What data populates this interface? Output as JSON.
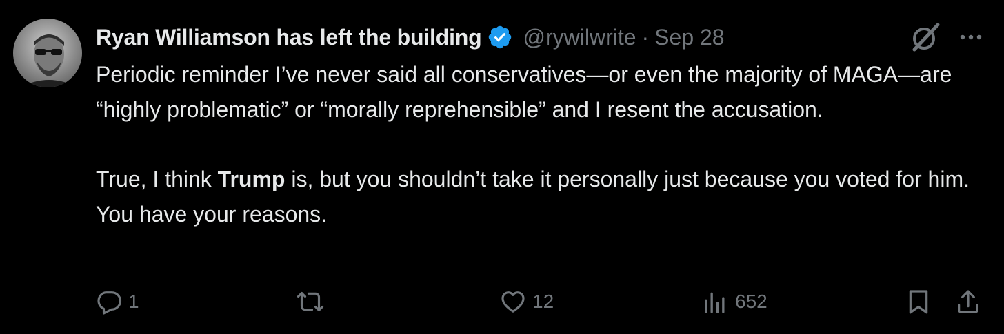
{
  "author": {
    "display_name": "Ryan Williamson has left the building",
    "verified": true,
    "handle": "@rywilwrite",
    "separator": "·",
    "date": "Sep 28"
  },
  "tweet": {
    "paragraph1": "Periodic reminder I’ve never said all conservatives—or even the majority of MAGA—are “highly problematic” or “morally reprehensible” and I resent the accusation.",
    "paragraph2_before": "True, I think ",
    "paragraph2_bold": "Trump",
    "paragraph2_after": " is, but you shouldn’t take it personally just because you voted for him. You have your reasons."
  },
  "actions": {
    "replies": "1",
    "reposts": "",
    "likes": "12",
    "views": "652"
  },
  "icons": [
    "grok-icon",
    "more-icon",
    "reply-icon",
    "repost-icon",
    "like-icon",
    "views-icon",
    "bookmark-icon",
    "share-icon",
    "verified-badge-icon"
  ],
  "colors": {
    "background": "#000000",
    "text": "#e7e9ea",
    "secondary": "#71767b",
    "verified": "#1d9bf0"
  }
}
